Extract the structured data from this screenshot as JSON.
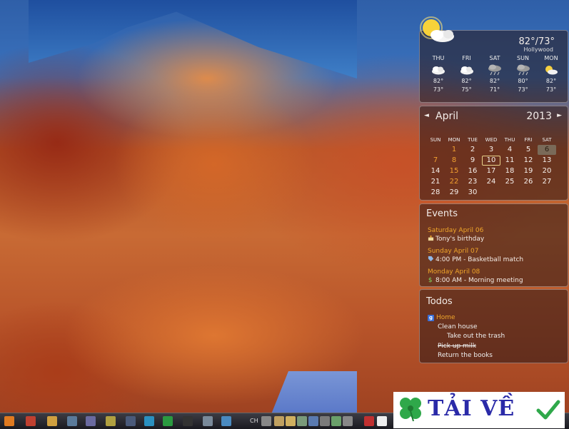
{
  "weather": {
    "current_temp": "82°/73°",
    "location": "Hollywood",
    "forecast": [
      {
        "day": "THU",
        "icon": "partly-cloudy-icon",
        "high": "82°",
        "low": "73°"
      },
      {
        "day": "FRI",
        "icon": "partly-cloudy-icon",
        "high": "82°",
        "low": "75°"
      },
      {
        "day": "SAT",
        "icon": "storm-icon",
        "high": "82°",
        "low": "71°"
      },
      {
        "day": "SUN",
        "icon": "storm-icon",
        "high": "80°",
        "low": "73°"
      },
      {
        "day": "MON",
        "icon": "sunny-cloud-icon",
        "high": "82°",
        "low": "73°"
      }
    ]
  },
  "calendar": {
    "month": "April",
    "year": "2013",
    "prev": "◄",
    "next": "►",
    "weekdays": [
      "SUN",
      "MON",
      "TUE",
      "WED",
      "THU",
      "FRI",
      "SAT"
    ],
    "weeks": [
      [
        "",
        "1",
        "2",
        "3",
        "4",
        "5",
        "6"
      ],
      [
        "7",
        "8",
        "9",
        "10",
        "11",
        "12",
        "13"
      ],
      [
        "14",
        "15",
        "16",
        "17",
        "18",
        "19",
        "20"
      ],
      [
        "21",
        "22",
        "23",
        "24",
        "25",
        "26",
        "27"
      ],
      [
        "28",
        "29",
        "30",
        "",
        "",
        "",
        ""
      ]
    ],
    "highlighted_days": [
      "1",
      "7",
      "8",
      "15",
      "22"
    ],
    "today": "10",
    "selected": "6"
  },
  "events": {
    "title": "Events",
    "items": [
      {
        "date": "Saturday April 06",
        "icon": "cake-icon",
        "text": "Tony's birthday"
      },
      {
        "date": "Sunday April 07",
        "icon": "tag-icon",
        "text": "4:00 PM - Basketball match"
      },
      {
        "date": "Monday April 08",
        "icon": "dollar-icon",
        "text": "8:00 AM - Morning meeting"
      }
    ]
  },
  "todos": {
    "title": "Todos",
    "list_name": "Home",
    "items": [
      {
        "text": "Clean house",
        "indent": 1,
        "done": false
      },
      {
        "text": "Take out the trash",
        "indent": 2,
        "done": false
      },
      {
        "text": "Pick up milk",
        "indent": 1,
        "done": true
      },
      {
        "text": "Return the books",
        "indent": 1,
        "done": false
      }
    ]
  },
  "taskbar": {
    "language": "CH"
  },
  "watermark": {
    "brand": "TẢI VỀ"
  },
  "colors": {
    "accent_orange": "#f0a62a",
    "panel_bg": "#281616"
  }
}
